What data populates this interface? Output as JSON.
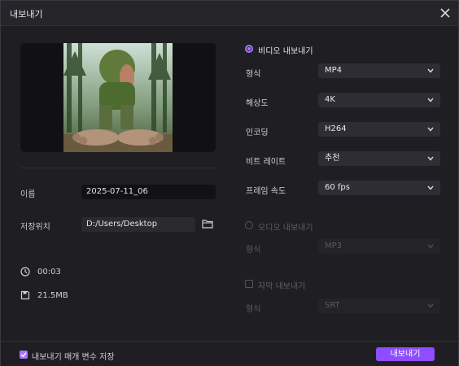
{
  "window": {
    "title": "내보내기"
  },
  "left": {
    "name_label": "이름",
    "name_value": "2025-07-11_06",
    "path_label": "저장위치",
    "path_value": "D:/Users/Desktop",
    "duration": "00:03",
    "file_size": "21.5MB"
  },
  "video_export": {
    "label": "비디오 내보내기",
    "selected": true,
    "fields": [
      {
        "label": "형식",
        "value": "MP4"
      },
      {
        "label": "해상도",
        "value": "4K"
      },
      {
        "label": "인코딩",
        "value": "H264"
      },
      {
        "label": "비트 레이트",
        "value": "추천"
      },
      {
        "label": "프레임 속도",
        "value": "60  fps"
      }
    ]
  },
  "audio_export": {
    "label": "오디오 내보내기",
    "selected": false,
    "field_label": "형식",
    "field_value": "MP3"
  },
  "subtitle_export": {
    "label": "자막 내보내기",
    "checked": false,
    "field_label": "형식",
    "field_value": "SRT"
  },
  "footer": {
    "remember_label": "내보내기 매개 변수 저장",
    "remember_checked": true,
    "export_button": "내보내기"
  },
  "colors": {
    "accent": "#8e4dff",
    "background": "#1f1f23"
  },
  "icons": [
    "close-icon",
    "folder-icon",
    "clock-icon",
    "save-icon",
    "chevron-down-icon",
    "check-icon"
  ]
}
